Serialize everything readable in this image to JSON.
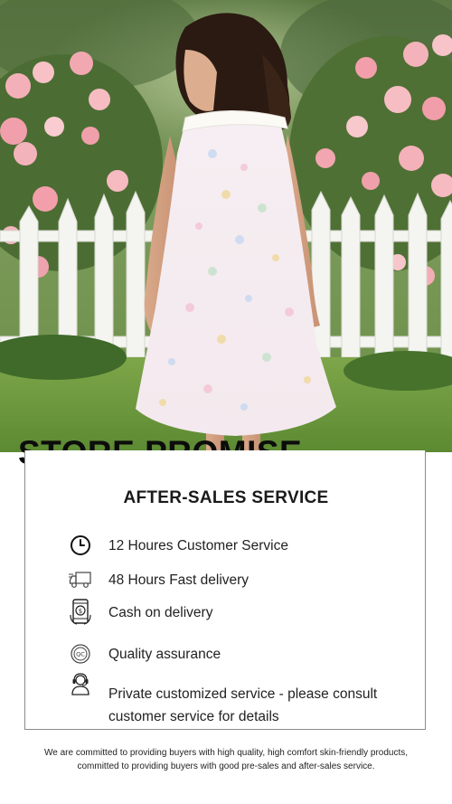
{
  "banner": {
    "title": "STORE PROMISE"
  },
  "section": {
    "heading": "AFTER-SALES SERVICE",
    "items": [
      {
        "icon": "clock-icon",
        "label": "12 Houres Customer Service"
      },
      {
        "icon": "delivery-truck-icon",
        "label": "48 Hours Fast delivery"
      },
      {
        "icon": "phone-payment-icon",
        "label": "Cash on delivery"
      },
      {
        "icon": "quality-badge-icon",
        "label": "Quality assurance"
      },
      {
        "icon": "customer-support-icon",
        "label": "Private customized service - please consult customer service for details"
      }
    ]
  },
  "footer": {
    "line1": "We are committed to providing buyers with high quality, high comfort skin-friendly products,",
    "line2": "committed to providing buyers with good pre-sales and after-sales service."
  },
  "colors": {
    "text": "#111111",
    "border": "#8a8a8a",
    "background": "#ffffff"
  }
}
